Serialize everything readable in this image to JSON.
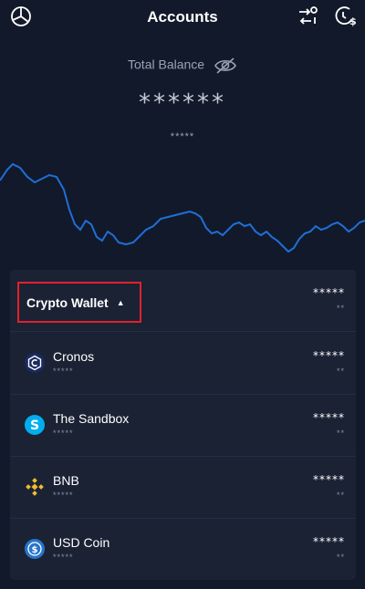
{
  "header": {
    "title": "Accounts",
    "left_icon": "pie-chart-icon",
    "right_icons": [
      "transfer-icon",
      "price-alert-icon"
    ]
  },
  "balance": {
    "label": "Total Balance",
    "amount": "******",
    "sub": "*****",
    "visibility_icon": "eye-off-icon"
  },
  "wallet": {
    "title": "Crypto Wallet",
    "amount": "*****",
    "sub": "**",
    "expanded": true
  },
  "coins": [
    {
      "name": "Cronos",
      "sub": "*****",
      "amount": "*****",
      "amount_sub": "**",
      "icon": "cronos-icon",
      "color": "#1b2a5e"
    },
    {
      "name": "The Sandbox",
      "sub": "*****",
      "amount": "*****",
      "amount_sub": "**",
      "icon": "sandbox-icon",
      "color": "#00aeef"
    },
    {
      "name": "BNB",
      "sub": "*****",
      "amount": "*****",
      "amount_sub": "**",
      "icon": "bnb-icon",
      "color": "#f3ba2f"
    },
    {
      "name": "USD Coin",
      "sub": "*****",
      "amount": "*****",
      "amount_sub": "**",
      "icon": "usdc-icon",
      "color": "#2775ca"
    }
  ],
  "colors": {
    "background": "#12192a",
    "panel": "#1a2234",
    "chart_line": "#1f6fd6",
    "highlight_box": "#e3202a"
  }
}
